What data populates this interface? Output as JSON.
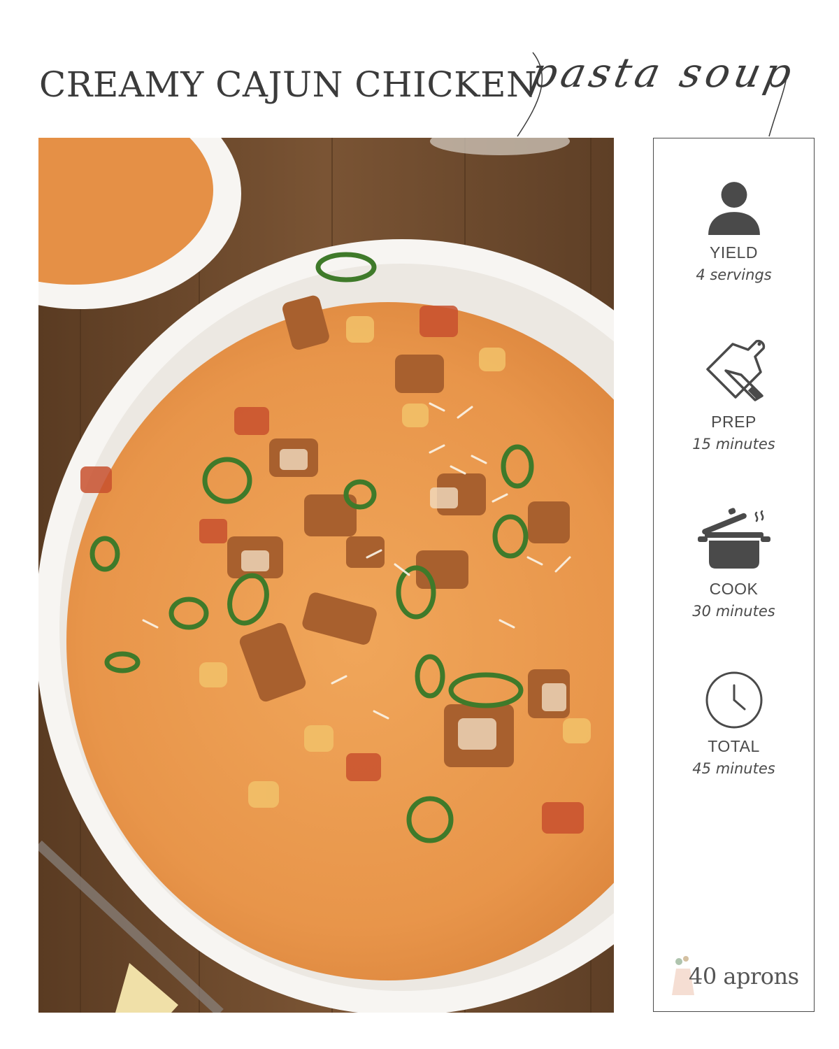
{
  "title": {
    "main": "CREAMY CAJUN CHICKEN",
    "script": "pasta soup"
  },
  "sidebar": {
    "stats": [
      {
        "icon": "person-icon",
        "label": "YIELD",
        "value": "4 servings"
      },
      {
        "icon": "cutting-board-knife-icon",
        "label": "PREP",
        "value": "15 minutes"
      },
      {
        "icon": "cooking-pot-icon",
        "label": "COOK",
        "value": "30 minutes"
      },
      {
        "icon": "clock-icon",
        "label": "TOTAL",
        "value": "45 minutes"
      }
    ],
    "logo": "40 aprons"
  },
  "colors": {
    "text": "#3b3b3b",
    "icon": "#4a4a4a",
    "soup": "#e8954a",
    "bowl": "#f7f5f2",
    "wood": "#6b4a2e"
  }
}
